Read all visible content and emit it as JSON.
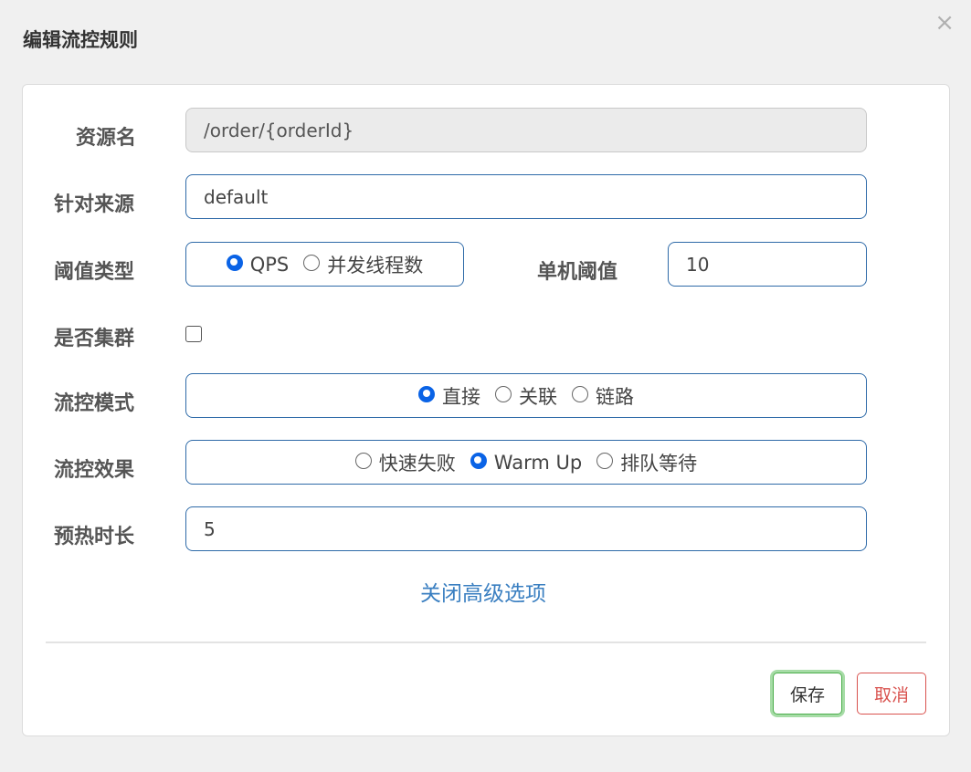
{
  "dialog": {
    "title": "编辑流控规则",
    "close_glyph": "×"
  },
  "form": {
    "resource": {
      "label": "资源名",
      "value": "/order/{orderId}"
    },
    "limit_app": {
      "label": "针对来源",
      "value": "default"
    },
    "grade": {
      "label": "阈值类型",
      "options": [
        "QPS",
        "并发线程数"
      ],
      "selected": "QPS"
    },
    "count": {
      "label": "单机阈值",
      "value": "10"
    },
    "cluster": {
      "label": "是否集群",
      "checked": false
    },
    "strategy": {
      "label": "流控模式",
      "options": [
        "直接",
        "关联",
        "链路"
      ],
      "selected": "直接"
    },
    "control_behavior": {
      "label": "流控效果",
      "options": [
        "快速失败",
        "Warm Up",
        "排队等待"
      ],
      "selected": "Warm Up"
    },
    "warmup": {
      "label": "预热时长",
      "value": "5"
    },
    "advanced_link": "关闭高级选项"
  },
  "footer": {
    "save_label": "保存",
    "cancel_label": "取消"
  },
  "colors": {
    "accent_blue": "#0a63e6",
    "border_blue": "#2e6aa8",
    "link_blue": "#3a7fc1",
    "save_green": "#4cae4c",
    "cancel_red": "#d9534f"
  },
  "icons": {
    "close": "close-icon"
  }
}
